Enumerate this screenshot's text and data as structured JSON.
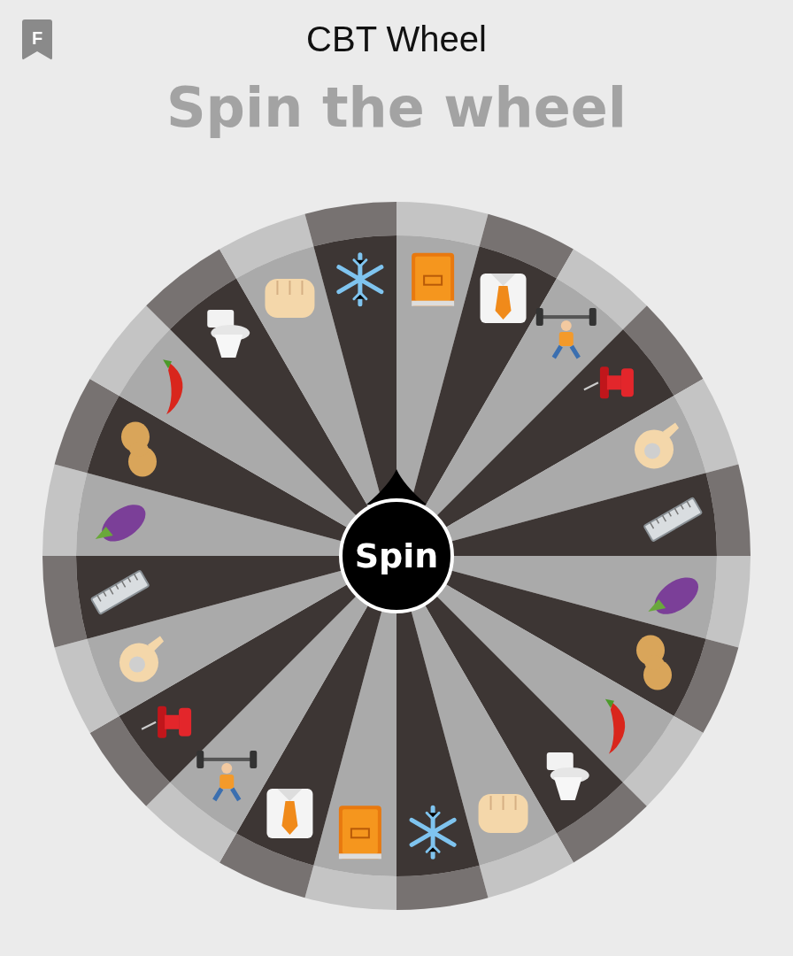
{
  "app_icon": {
    "letter": "F"
  },
  "window": {
    "title": "CBT Wheel"
  },
  "heading": "Spin the wheel",
  "wheel": {
    "segments": [
      {
        "kind": "book",
        "color": "#aaaaaa"
      },
      {
        "kind": "shirt",
        "color": "#3d3634"
      },
      {
        "kind": "lifter",
        "color": "#aaaaaa"
      },
      {
        "kind": "pushpin",
        "color": "#3d3634"
      },
      {
        "kind": "okhand",
        "color": "#aaaaaa"
      },
      {
        "kind": "ruler",
        "color": "#3d3634"
      },
      {
        "kind": "eggplant",
        "color": "#aaaaaa"
      },
      {
        "kind": "peanut",
        "color": "#3d3634"
      },
      {
        "kind": "chili",
        "color": "#aaaaaa"
      },
      {
        "kind": "toilet",
        "color": "#3d3634"
      },
      {
        "kind": "fist",
        "color": "#aaaaaa"
      },
      {
        "kind": "snowflake",
        "color": "#3d3634"
      },
      {
        "kind": "book",
        "color": "#aaaaaa"
      },
      {
        "kind": "shirt",
        "color": "#3d3634"
      },
      {
        "kind": "lifter",
        "color": "#aaaaaa"
      },
      {
        "kind": "pushpin",
        "color": "#3d3634"
      },
      {
        "kind": "okhand",
        "color": "#aaaaaa"
      },
      {
        "kind": "ruler",
        "color": "#3d3634"
      },
      {
        "kind": "eggplant",
        "color": "#aaaaaa"
      },
      {
        "kind": "peanut",
        "color": "#3d3634"
      },
      {
        "kind": "chili",
        "color": "#aaaaaa"
      },
      {
        "kind": "toilet",
        "color": "#3d3634"
      },
      {
        "kind": "fist",
        "color": "#aaaaaa"
      },
      {
        "kind": "snowflake",
        "color": "#3d3634"
      }
    ],
    "button": "Spin"
  }
}
